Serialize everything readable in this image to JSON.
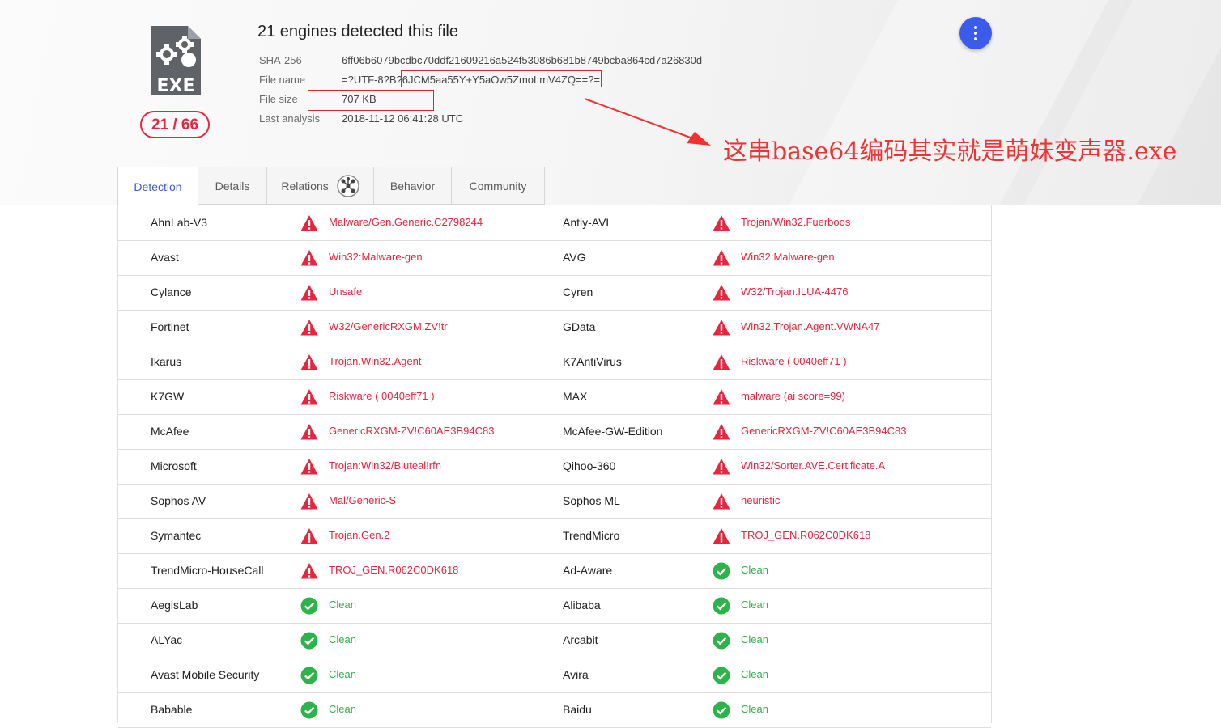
{
  "report": {
    "title": "21 engines detected this file",
    "score": "21 / 66",
    "file_type_icon": "exe-file-icon",
    "meta": [
      {
        "label": "SHA-256",
        "value": "6ff06b6079bcdbc70ddf21609216a524f53086b681b8749bcba864cd7a26830d"
      },
      {
        "label": "File name",
        "value": "=?UTF-8?B?6JCM5aa55Y+Y5aOw5ZmoLmV4ZQ==?="
      },
      {
        "label": "File size",
        "value": "707 KB"
      },
      {
        "label": "Last analysis",
        "value": "2018-11-12 06:41:28 UTC"
      }
    ]
  },
  "annotation": {
    "text": "这串base64编码其实就是萌妹变声器.exe",
    "color": "#f03233"
  },
  "fab": {
    "icon": "more-vert-icon",
    "color": "#3b5bea"
  },
  "tabs": [
    {
      "label": "Detection",
      "active": true
    },
    {
      "label": "Details",
      "active": false
    },
    {
      "label": "Relations",
      "active": false,
      "icon": "graph-icon"
    },
    {
      "label": "Behavior",
      "active": false
    },
    {
      "label": "Community",
      "active": false
    }
  ],
  "colors": {
    "malicious": "#e8253f",
    "clean": "#2cb34a",
    "accent": "#3f58d6"
  },
  "detections": [
    {
      "left": {
        "engine": "AhnLab-V3",
        "status": "malicious",
        "result": "Malware/Gen.Generic.C2798244"
      },
      "right": {
        "engine": "Antiy-AVL",
        "status": "malicious",
        "result": "Trojan/Win32.Fuerboos"
      }
    },
    {
      "left": {
        "engine": "Avast",
        "status": "malicious",
        "result": "Win32:Malware-gen"
      },
      "right": {
        "engine": "AVG",
        "status": "malicious",
        "result": "Win32:Malware-gen"
      }
    },
    {
      "left": {
        "engine": "Cylance",
        "status": "malicious",
        "result": "Unsafe"
      },
      "right": {
        "engine": "Cyren",
        "status": "malicious",
        "result": "W32/Trojan.ILUA-4476"
      }
    },
    {
      "left": {
        "engine": "Fortinet",
        "status": "malicious",
        "result": "W32/GenericRXGM.ZV!tr"
      },
      "right": {
        "engine": "GData",
        "status": "malicious",
        "result": "Win32.Trojan.Agent.VWNA47"
      }
    },
    {
      "left": {
        "engine": "Ikarus",
        "status": "malicious",
        "result": "Trojan.Win32.Agent"
      },
      "right": {
        "engine": "K7AntiVirus",
        "status": "malicious",
        "result": "Riskware ( 0040eff71 )"
      }
    },
    {
      "left": {
        "engine": "K7GW",
        "status": "malicious",
        "result": "Riskware ( 0040eff71 )"
      },
      "right": {
        "engine": "MAX",
        "status": "malicious",
        "result": "malware (ai score=99)"
      }
    },
    {
      "left": {
        "engine": "McAfee",
        "status": "malicious",
        "result": "GenericRXGM-ZV!C60AE3B94C83"
      },
      "right": {
        "engine": "McAfee-GW-Edition",
        "status": "malicious",
        "result": "GenericRXGM-ZV!C60AE3B94C83"
      }
    },
    {
      "left": {
        "engine": "Microsoft",
        "status": "malicious",
        "result": "Trojan:Win32/Bluteal!rfn"
      },
      "right": {
        "engine": "Qihoo-360",
        "status": "malicious",
        "result": "Win32/Sorter.AVE.Certificate.A"
      }
    },
    {
      "left": {
        "engine": "Sophos AV",
        "status": "malicious",
        "result": "Mal/Generic-S"
      },
      "right": {
        "engine": "Sophos ML",
        "status": "malicious",
        "result": "heuristic"
      }
    },
    {
      "left": {
        "engine": "Symantec",
        "status": "malicious",
        "result": "Trojan.Gen.2"
      },
      "right": {
        "engine": "TrendMicro",
        "status": "malicious",
        "result": "TROJ_GEN.R062C0DK618"
      }
    },
    {
      "left": {
        "engine": "TrendMicro-HouseCall",
        "status": "malicious",
        "result": "TROJ_GEN.R062C0DK618"
      },
      "right": {
        "engine": "Ad-Aware",
        "status": "clean",
        "result": "Clean"
      }
    },
    {
      "left": {
        "engine": "AegisLab",
        "status": "clean",
        "result": "Clean"
      },
      "right": {
        "engine": "Alibaba",
        "status": "clean",
        "result": "Clean"
      }
    },
    {
      "left": {
        "engine": "ALYac",
        "status": "clean",
        "result": "Clean"
      },
      "right": {
        "engine": "Arcabit",
        "status": "clean",
        "result": "Clean"
      }
    },
    {
      "left": {
        "engine": "Avast Mobile Security",
        "status": "clean",
        "result": "Clean"
      },
      "right": {
        "engine": "Avira",
        "status": "clean",
        "result": "Clean"
      }
    },
    {
      "left": {
        "engine": "Babable",
        "status": "clean",
        "result": "Clean"
      },
      "right": {
        "engine": "Baidu",
        "status": "clean",
        "result": "Clean"
      }
    }
  ]
}
